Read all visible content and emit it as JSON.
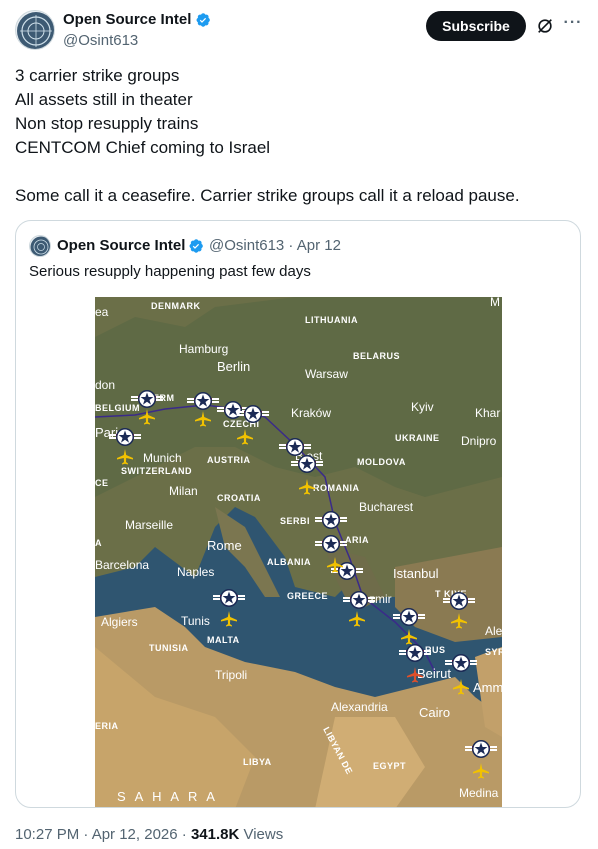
{
  "author": {
    "name": "Open Source Intel",
    "handle": "@Osint613",
    "subscribe_label": "Subscribe",
    "verified_icon": "verified-badge-icon",
    "more_label": "···"
  },
  "tweet": {
    "lines": [
      "3 carrier strike groups",
      "All assets still in theater",
      "Non stop resupply trains",
      "CENTCOM Chief coming to Israel"
    ],
    "closing": "Some call it a ceasefire. Carrier strike groups call it a reload pause."
  },
  "quote": {
    "name": "Open Source Intel",
    "handle_date": "@Osint613 · Apr 12",
    "text": "Serious resupply happening past few days",
    "map_labels": {
      "denmark": "DENMARK",
      "lithuania": "LITHUANIA",
      "hamburg": "Hamburg",
      "berlin": "Berlin",
      "belarus": "BELARUS",
      "warsaw": "Warsaw",
      "don": "don",
      "belgium": "BELGIUM",
      "ermany": "ERM",
      "krakow": "Kraków",
      "kyiv": "Kyiv",
      "khar": "Khar",
      "paris": "Pari",
      "czechia": "CZECHI",
      "ukraine": "UKRAINE",
      "dnipro": "Dnipro",
      "munich": "Munich",
      "austria": "AUSTRIA",
      "budapest": "B   est",
      "moldova": "MOLDOVA",
      "switzerland": "SWITZERLAND",
      "ce": "CE",
      "milan": "Milan",
      "romania": "ROMANIA",
      "croatia": "CROATIA",
      "bucharest": "Bucharest",
      "marseille": "Marseille",
      "serbia": "SERBI",
      "aria": "ARIA",
      "a": "A",
      "rome": "Rome",
      "barcelona": "Barcelona",
      "naples": "Naples",
      "albania": "ALBANIA",
      "istanbul": "Istanbul",
      "greece": "GREECE",
      "izmir": "zmir",
      "tukiye": "T  KIYE",
      "algiers": "Algiers",
      "tunis": "Tunis",
      "malta": "MALTA",
      "tunisia": "TUNISIA",
      "cyprus": "RUS",
      "ale": "Ale",
      "syr": "SYR",
      "beirut": "Beirut",
      "tripoli": "Tripoli",
      "amm": "Amm",
      "alexandria": "Alexandria",
      "cairo": "Cairo",
      "eria": "ERIA",
      "libya": "LIBYA",
      "egypt": "EGYPT",
      "libyan_desert": "LIBYAN DE",
      "sahara": "S A H A R A",
      "medina": "Medina",
      "m": "M",
      "ea": "ea"
    }
  },
  "footer": {
    "time": "10:27 PM · Apr 12, 2026 · ",
    "views_count": "341.8K",
    "views_label": " Views"
  }
}
